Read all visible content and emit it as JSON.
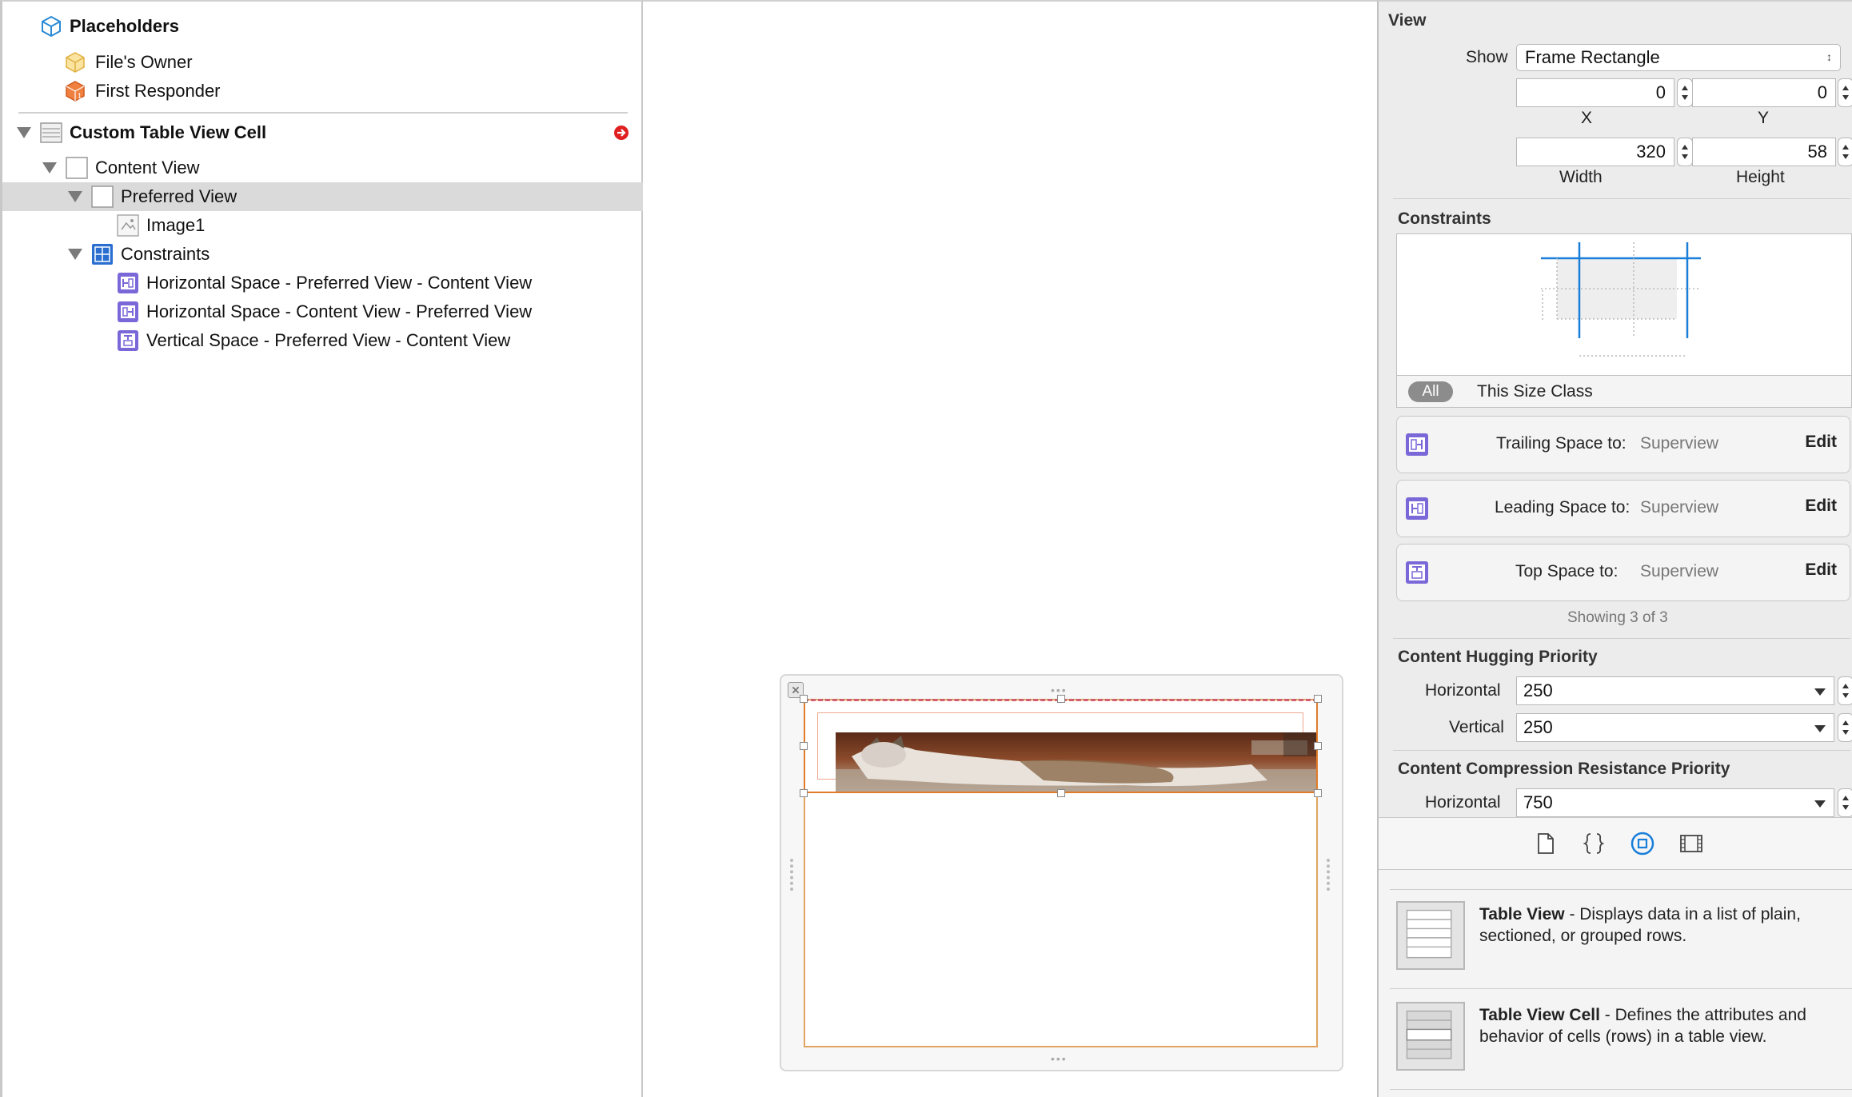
{
  "outline": {
    "placeholders_label": "Placeholders",
    "files_owner": "File's Owner",
    "first_responder": "First Responder",
    "cell_label": "Custom Table View Cell",
    "content_view": "Content View",
    "preferred_view": "Preferred View",
    "image1": "Image1",
    "constraints": "Constraints",
    "constraint_items": [
      "Horizontal Space - Preferred View - Content View",
      "Horizontal Space - Content View - Preferred View",
      "Vertical Space - Preferred View - Content View"
    ]
  },
  "inspector": {
    "view_header": "View",
    "show_label": "Show",
    "show_value": "Frame Rectangle",
    "x_value": "0",
    "y_value": "0",
    "x_label": "X",
    "y_label": "Y",
    "width_value": "320",
    "height_value": "58",
    "width_label": "Width",
    "height_label": "Height",
    "constraints_header": "Constraints",
    "size_class_all": "All",
    "size_class_label": "This Size Class",
    "constraint_rows": [
      {
        "title": "Trailing Space to:",
        "target": "Superview",
        "action": "Edit"
      },
      {
        "title": "Leading Space to:",
        "target": "Superview",
        "action": "Edit"
      },
      {
        "title": "Top Space to:",
        "target": "Superview",
        "action": "Edit"
      }
    ],
    "showing_text": "Showing 3 of 3",
    "hugging_header": "Content Hugging Priority",
    "hugging_horizontal_label": "Horizontal",
    "hugging_horizontal_value": "250",
    "hugging_vertical_label": "Vertical",
    "hugging_vertical_value": "250",
    "compression_header": "Content Compression Resistance Priority",
    "compression_horizontal_label": "Horizontal",
    "compression_horizontal_value": "750"
  },
  "library": [
    {
      "title": "Table View",
      "desc": " - Displays data in a list of plain, sectioned, or grouped rows."
    },
    {
      "title": "Table View Cell",
      "desc": " - Defines the attributes and behavior of cells (rows) in a table view."
    }
  ],
  "colors": {
    "selection": "#dadada",
    "accent_blue": "#1a7fd9",
    "constraint_icon": "#6b5bd6",
    "error_red": "#e02020"
  }
}
